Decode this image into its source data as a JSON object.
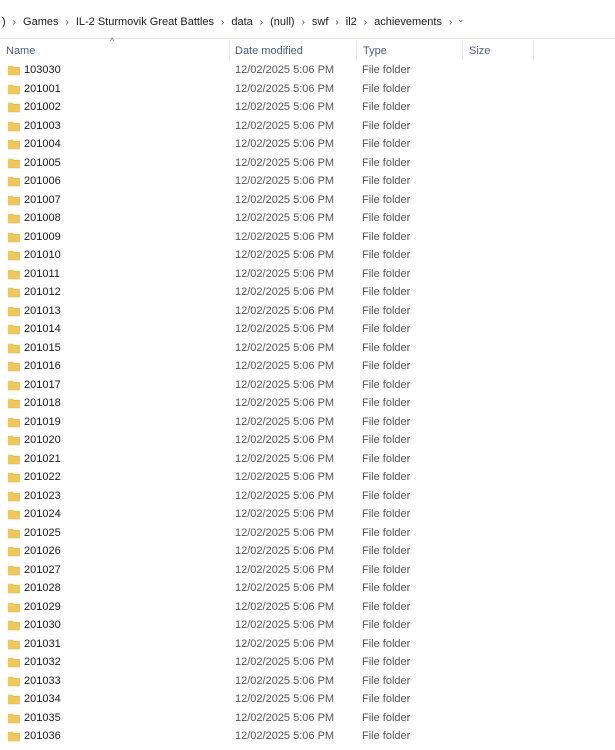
{
  "breadcrumb": {
    "items": [
      ")",
      "Games",
      "IL-2 Sturmovik Great Battles",
      "data",
      "(null)",
      "swf",
      "il2",
      "achievements"
    ],
    "separator": "›",
    "dropdown_glyph": "⌄"
  },
  "columns": {
    "sort_glyph": "^",
    "name": "Name",
    "date": "Date modified",
    "type": "Type",
    "size": "Size"
  },
  "colors": {
    "folder": "#f0c85a",
    "folder_tab": "#e0b440",
    "header_text": "#4a5a7a"
  },
  "files": [
    {
      "name": "103030",
      "date": "12/02/2025 5:06 PM",
      "type": "File folder"
    },
    {
      "name": "201001",
      "date": "12/02/2025 5:06 PM",
      "type": "File folder"
    },
    {
      "name": "201002",
      "date": "12/02/2025 5:06 PM",
      "type": "File folder"
    },
    {
      "name": "201003",
      "date": "12/02/2025 5:06 PM",
      "type": "File folder"
    },
    {
      "name": "201004",
      "date": "12/02/2025 5:06 PM",
      "type": "File folder"
    },
    {
      "name": "201005",
      "date": "12/02/2025 5:06 PM",
      "type": "File folder"
    },
    {
      "name": "201006",
      "date": "12/02/2025 5:06 PM",
      "type": "File folder"
    },
    {
      "name": "201007",
      "date": "12/02/2025 5:06 PM",
      "type": "File folder"
    },
    {
      "name": "201008",
      "date": "12/02/2025 5:06 PM",
      "type": "File folder"
    },
    {
      "name": "201009",
      "date": "12/02/2025 5:06 PM",
      "type": "File folder"
    },
    {
      "name": "201010",
      "date": "12/02/2025 5:06 PM",
      "type": "File folder"
    },
    {
      "name": "201011",
      "date": "12/02/2025 5:06 PM",
      "type": "File folder"
    },
    {
      "name": "201012",
      "date": "12/02/2025 5:06 PM",
      "type": "File folder"
    },
    {
      "name": "201013",
      "date": "12/02/2025 5:06 PM",
      "type": "File folder"
    },
    {
      "name": "201014",
      "date": "12/02/2025 5:06 PM",
      "type": "File folder"
    },
    {
      "name": "201015",
      "date": "12/02/2025 5:06 PM",
      "type": "File folder"
    },
    {
      "name": "201016",
      "date": "12/02/2025 5:06 PM",
      "type": "File folder"
    },
    {
      "name": "201017",
      "date": "12/02/2025 5:06 PM",
      "type": "File folder"
    },
    {
      "name": "201018",
      "date": "12/02/2025 5:06 PM",
      "type": "File folder"
    },
    {
      "name": "201019",
      "date": "12/02/2025 5:06 PM",
      "type": "File folder"
    },
    {
      "name": "201020",
      "date": "12/02/2025 5:06 PM",
      "type": "File folder"
    },
    {
      "name": "201021",
      "date": "12/02/2025 5:06 PM",
      "type": "File folder"
    },
    {
      "name": "201022",
      "date": "12/02/2025 5:06 PM",
      "type": "File folder"
    },
    {
      "name": "201023",
      "date": "12/02/2025 5:06 PM",
      "type": "File folder"
    },
    {
      "name": "201024",
      "date": "12/02/2025 5:06 PM",
      "type": "File folder"
    },
    {
      "name": "201025",
      "date": "12/02/2025 5:06 PM",
      "type": "File folder"
    },
    {
      "name": "201026",
      "date": "12/02/2025 5:06 PM",
      "type": "File folder"
    },
    {
      "name": "201027",
      "date": "12/02/2025 5:06 PM",
      "type": "File folder"
    },
    {
      "name": "201028",
      "date": "12/02/2025 5:06 PM",
      "type": "File folder"
    },
    {
      "name": "201029",
      "date": "12/02/2025 5:06 PM",
      "type": "File folder"
    },
    {
      "name": "201030",
      "date": "12/02/2025 5:06 PM",
      "type": "File folder"
    },
    {
      "name": "201031",
      "date": "12/02/2025 5:06 PM",
      "type": "File folder"
    },
    {
      "name": "201032",
      "date": "12/02/2025 5:06 PM",
      "type": "File folder"
    },
    {
      "name": "201033",
      "date": "12/02/2025 5:06 PM",
      "type": "File folder"
    },
    {
      "name": "201034",
      "date": "12/02/2025 5:06 PM",
      "type": "File folder"
    },
    {
      "name": "201035",
      "date": "12/02/2025 5:06 PM",
      "type": "File folder"
    },
    {
      "name": "201036",
      "date": "12/02/2025 5:06 PM",
      "type": "File folder"
    }
  ]
}
